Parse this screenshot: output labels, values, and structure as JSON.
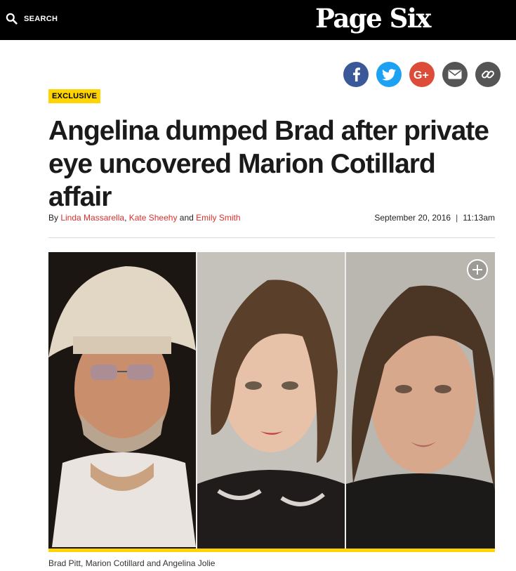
{
  "header": {
    "search_label": "SEARCH",
    "logo": "Page Six",
    "search_icon": "search-icon"
  },
  "share": [
    {
      "name": "facebook",
      "icon": "facebook-icon",
      "color": "#3b5998",
      "glyph": "f"
    },
    {
      "name": "twitter",
      "icon": "twitter-icon",
      "color": "#1da1f2",
      "glyph": "bird"
    },
    {
      "name": "google-plus",
      "icon": "google-plus-icon",
      "color": "#dd4b39",
      "glyph": "G+"
    },
    {
      "name": "email",
      "icon": "email-icon",
      "color": "#555555",
      "glyph": "envelope"
    },
    {
      "name": "link",
      "icon": "link-icon",
      "color": "#555555",
      "glyph": "chain"
    }
  ],
  "article": {
    "tag": "EXCLUSIVE",
    "headline": "Angelina dumped Brad after private eye uncovered Marion Cotillard affair",
    "byline_prefix": "By ",
    "authors": [
      "Linda Massarella",
      "Kate Sheehy",
      "Emily Smith"
    ],
    "author_sep_1": ", ",
    "author_sep_2": " and ",
    "date": "September 20, 2016",
    "date_sep": "|",
    "time": "11:13am"
  },
  "photo": {
    "caption": "Brad Pitt, Marion Cotillard and Angelina Jolie",
    "expand_icon": "plus-circle-icon",
    "accent": "#ffd400"
  }
}
